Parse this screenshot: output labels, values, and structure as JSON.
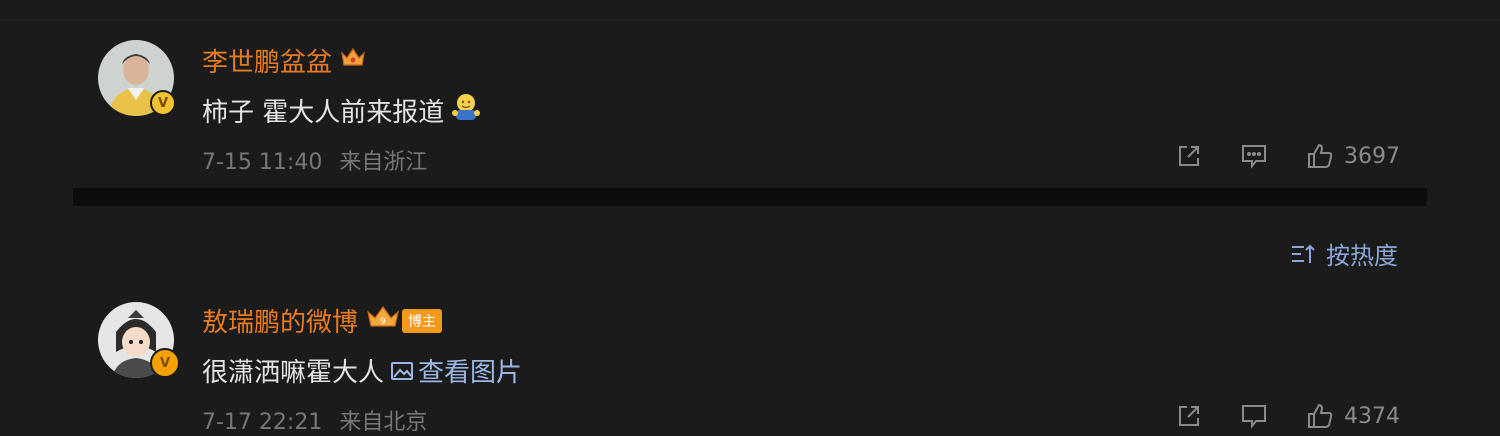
{
  "comments": [
    {
      "username": "李世鹏盆盆",
      "text": "柿子 霍大人前来报道",
      "time": "7-15 11:40",
      "location": "来自浙江",
      "likes": "3697",
      "badge_color": "#f1c232"
    },
    {
      "username": "敖瑞鹏的微博",
      "text": "很潇洒嘛霍大人",
      "link": "查看图片",
      "author_tag": "博主",
      "time": "7-17 22:21",
      "location": "来自北京",
      "likes": "4374",
      "badge_color": "#f2a100"
    }
  ],
  "sort": {
    "label": "按热度"
  },
  "icons": {
    "share": "share-icon",
    "reply": "comment-icon",
    "like": "thumbs-up-icon",
    "crown": "crown-icon",
    "verified": "verified-v-icon"
  },
  "badge_letter": "V",
  "colors": {
    "username": "#e87b1e",
    "link": "#9bb7e6",
    "background": "#1b1b1b"
  }
}
